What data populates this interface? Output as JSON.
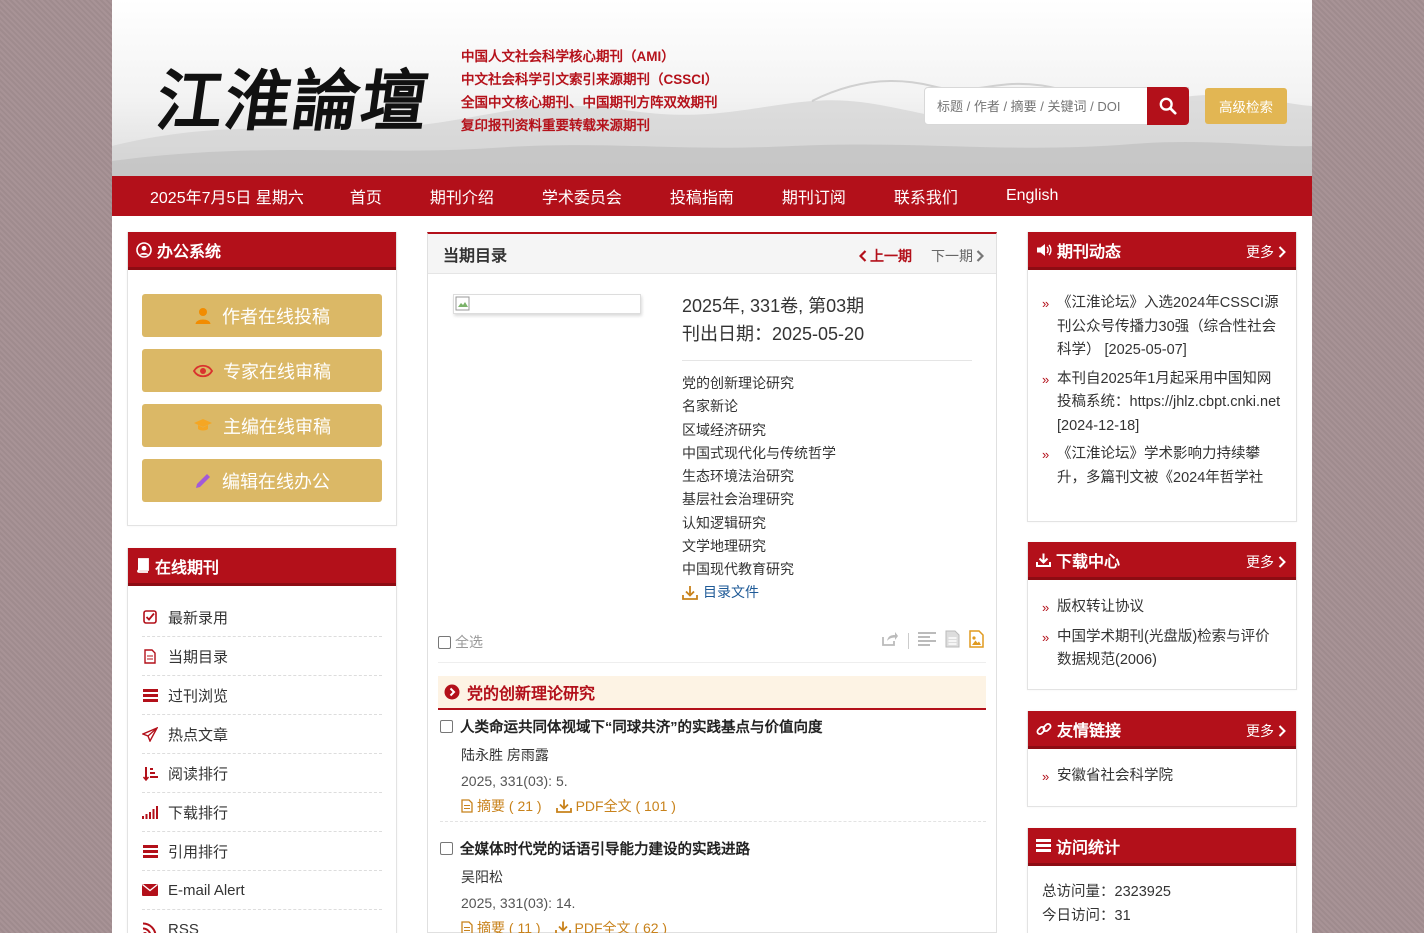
{
  "header": {
    "logo_text": "江淮論壇",
    "taglines": [
      "中国人文社会科学核心期刊（AMI）",
      "中文社会科学引文索引来源期刊（CSSCI）",
      "全国中文核心期刊、中国期刊方阵双效期刊",
      "复印报刊资料重要转载来源期刊"
    ],
    "search_placeholder": "标题 / 作者 / 摘要 / 关键词 / DOI",
    "advanced_search_label": "高级检索"
  },
  "nav": {
    "date": "2025年7月5日 星期六",
    "items": [
      "首页",
      "期刊介绍",
      "学术委员会",
      "投稿指南",
      "期刊订阅",
      "联系我们",
      "English"
    ]
  },
  "office": {
    "title": "办公系统",
    "buttons": [
      "作者在线投稿",
      "专家在线审稿",
      "主编在线审稿",
      "编辑在线办公"
    ]
  },
  "online_journal": {
    "title": "在线期刊",
    "items": [
      "最新录用",
      "当期目录",
      "过刊浏览",
      "热点文章",
      "阅读排行",
      "下载排行",
      "引用排行",
      "E-mail Alert",
      "RSS"
    ]
  },
  "current_issue": {
    "title": "当期目录",
    "prev_label": "上一期",
    "next_label": "下一期",
    "issue_line": "2025年, 331卷, 第03期",
    "publish_date": "刊出日期：2025-05-20",
    "columns": [
      "党的创新理论研究",
      "名家新论",
      "区域经济研究",
      "中国式现代化与传统哲学",
      "生态环境法治研究",
      "基层社会治理研究",
      "认知逻辑研究",
      "文学地理研究",
      "中国现代教育研究"
    ],
    "toc_file_label": "目录文件",
    "select_all_label": "全选",
    "section_title": "党的创新理论研究",
    "articles": [
      {
        "title": "人类命运共同体视域下“同球共济”的实践基点与价值向度",
        "authors": "陆永胜 房雨露",
        "cite": "2025, 331(03): 5.",
        "abstract_label": "摘要 ( 21 )",
        "pdf_label": "PDF全文 ( 101 )"
      },
      {
        "title": "全媒体时代党的话语引导能力建设的实践进路",
        "authors": "吴阳松",
        "cite": "2025, 331(03): 14.",
        "abstract_label": "摘要 ( 11 )",
        "pdf_label": "PDF全文 ( 62 )"
      }
    ]
  },
  "news": {
    "title": "期刊动态",
    "more_label": "更多",
    "items": [
      "《江淮论坛》入选2024年CSSCI源刊公众号传播力30强（综合性社会科学） [2025-05-07]",
      "本刊自2025年1月起采用中国知网投稿系统：https://jhlz.cbpt.cnki.net [2024-12-18]",
      "《江淮论坛》学术影响力持续攀升，多篇刊文被《2024年哲学社"
    ]
  },
  "downloads": {
    "title": "下载中心",
    "more_label": "更多",
    "items": [
      "版权转让协议",
      "中国学术期刊(光盘版)检索与评价数据规范(2006)"
    ]
  },
  "links": {
    "title": "友情链接",
    "more_label": "更多",
    "items": [
      "安徽省社会科学院"
    ]
  },
  "stats": {
    "title": "访问统计",
    "total": "总访问量：2323925",
    "today": "今日访问：31"
  },
  "colors": {
    "brand_red": "#b3101a",
    "gold": "#dbb866",
    "link_orange": "#c8821b",
    "link_blue": "#1e5a97"
  }
}
